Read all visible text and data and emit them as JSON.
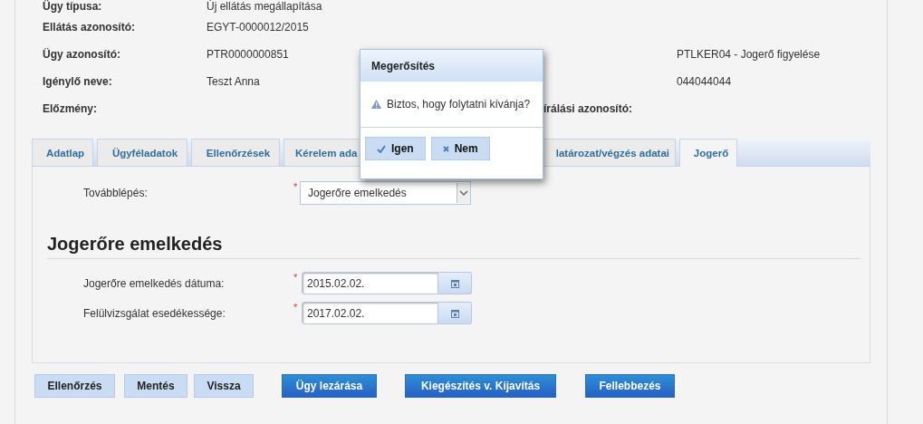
{
  "info": {
    "rows": [
      {
        "label": "Ügy típusa:",
        "value": "Új ellátás megállapítása",
        "right_label": "",
        "right_value": ""
      },
      {
        "label": "Ellátás azonosító:",
        "value": "EGYT-0000012/2015",
        "right_label": "",
        "right_value": ""
      },
      {
        "label": "Ügy azonosító:",
        "value": "PTR0000000851",
        "right_label": "",
        "right_value": "PTLKER04 - Jogerő figyelése"
      },
      {
        "label": "Igénylő neve:",
        "value": "Teszt Anna",
        "right_label": "",
        "right_value": "044044044"
      },
      {
        "label": "Előzmény:",
        "value": "",
        "right_label": "írálási azonosító:",
        "right_value": ""
      }
    ]
  },
  "tabs": [
    {
      "label": "Adatlap",
      "selected": false
    },
    {
      "label": "Ügyféladatok",
      "selected": false
    },
    {
      "label": "Ellenőrzések",
      "selected": false
    },
    {
      "label": "Kérelem ada",
      "selected": false
    },
    {
      "label": "latározat/végzés adatai",
      "selected": false
    },
    {
      "label": "Jogerő",
      "selected": true
    }
  ],
  "next_step": {
    "label": "Továbblépés:",
    "marker": "*",
    "value": "Jogerőre emelkedés"
  },
  "section": {
    "title": "Jogerőre emelkedés",
    "fields": [
      {
        "label": "Jogerőre emelkedés dátuma:",
        "marker": "*",
        "value": "2015.02.02."
      },
      {
        "label": "Felülvizsgálat esedékessége:",
        "marker": "*",
        "value": "2017.02.02."
      }
    ]
  },
  "buttons": [
    {
      "label": "Ellenőrzés",
      "kind": "light"
    },
    {
      "label": "Mentés",
      "kind": "light"
    },
    {
      "label": "Vissza",
      "kind": "light"
    },
    {
      "label": "Ügy lezárása",
      "kind": "primary"
    },
    {
      "label": "Kiegészítés v. Kijavítás",
      "kind": "primary"
    },
    {
      "label": "Fellebbezés",
      "kind": "primary"
    }
  ],
  "dialog": {
    "title": "Megerősítés",
    "message": "Biztos, hogy folytatni kívánja?",
    "buttons": [
      {
        "label": "Igen",
        "kind": "ok"
      },
      {
        "label": "Nem",
        "kind": "cancel"
      }
    ]
  }
}
